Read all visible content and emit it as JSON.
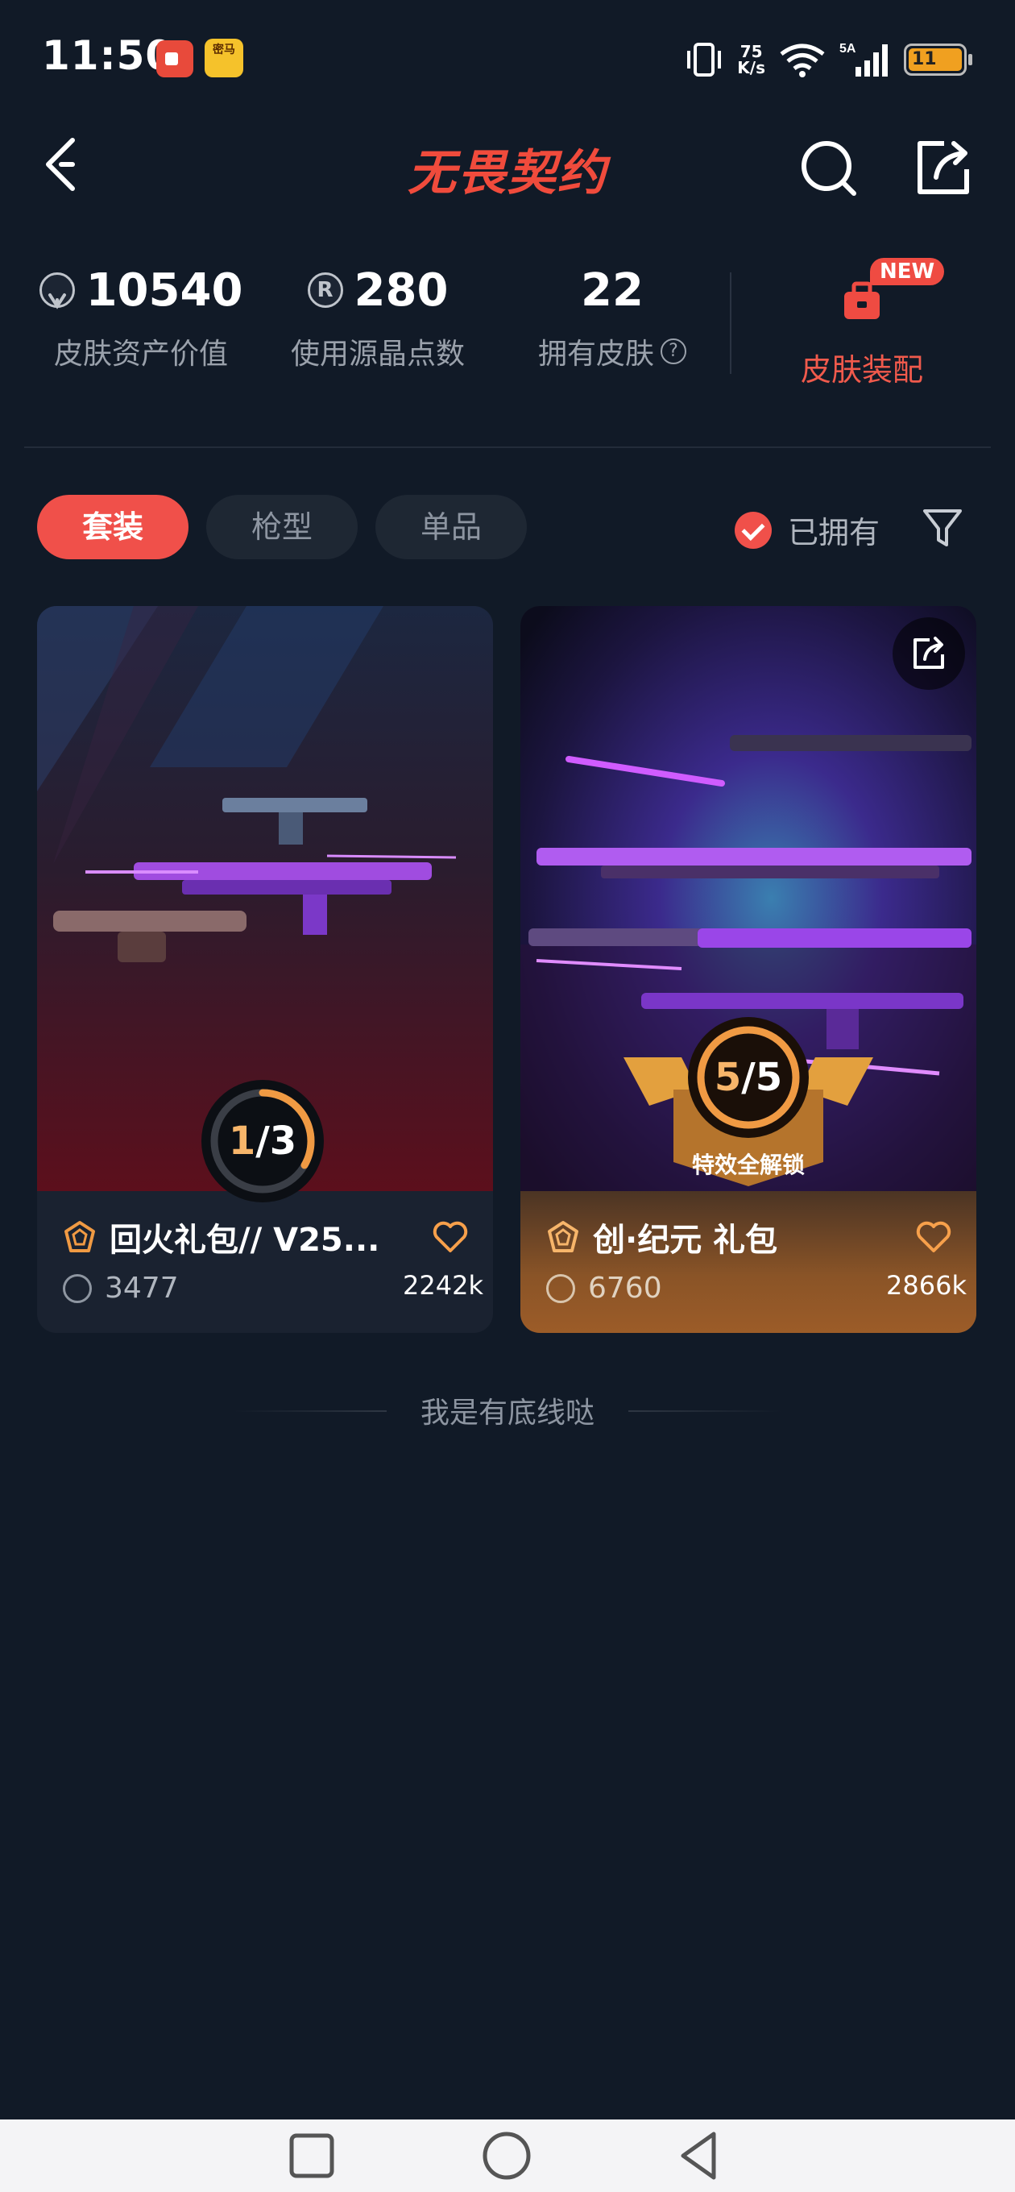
{
  "status_bar": {
    "time": "11:50",
    "notif_game": "密马",
    "net_speed_value": "75",
    "net_speed_unit": "K/s",
    "signal_labels": "5A",
    "wifi_label": "6",
    "battery_level": "11"
  },
  "header": {
    "title": "无畏契约"
  },
  "stats": {
    "asset_value": "10540",
    "asset_label": "皮肤资产价值",
    "crystal_value": "280",
    "crystal_label": "使用源晶点数",
    "skins_value": "22",
    "skins_label": "拥有皮肤",
    "equip_badge": "NEW",
    "equip_label": "皮肤装配"
  },
  "filters": {
    "tabs": [
      {
        "label": "套装",
        "active": true
      },
      {
        "label": "枪型",
        "active": false
      },
      {
        "label": "单品",
        "active": false
      }
    ],
    "owned_label": "已拥有"
  },
  "cards": [
    {
      "name": "回火礼包// V25...",
      "price": "3477",
      "count": "2242k",
      "progress_current": "1",
      "progress_total": "3",
      "progress_fraction": 0.333
    },
    {
      "name": "创·纪元 礼包",
      "price": "6760",
      "count": "2866k",
      "progress_current": "5",
      "progress_total": "5",
      "progress_fraction": 1.0,
      "unlock_label": "特效全解锁"
    }
  ],
  "footer": {
    "end_text": "我是有底线哒"
  },
  "colors": {
    "accent": "#f0504a",
    "background": "#111a27",
    "orange": "#f7a04b"
  }
}
